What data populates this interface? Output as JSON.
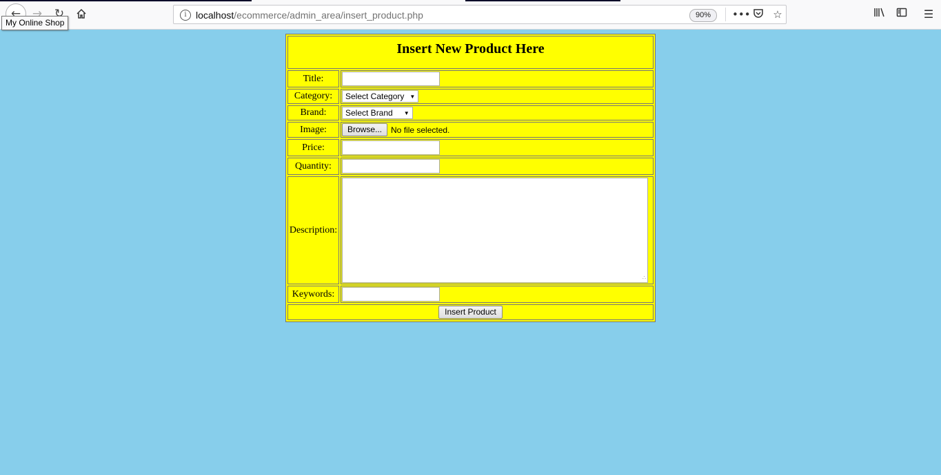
{
  "browser": {
    "tooltip": "My Online Shop",
    "url_host": "localhost",
    "url_path": "/ecommerce/admin_area/insert_product.php",
    "zoom": "90%",
    "icons": [
      "back-icon",
      "forward-icon",
      "reload-icon",
      "home-icon",
      "info-icon",
      "more-icon",
      "pocket-icon",
      "bookmark-star-icon",
      "library-icon",
      "sidebar-icon",
      "menu-icon"
    ]
  },
  "form": {
    "heading": "Insert New Product Here",
    "title_label": "Title:",
    "category_label": "Category:",
    "category_value": "Select Category",
    "brand_label": "Brand:",
    "brand_value": "Select Brand",
    "image_label": "Image:",
    "browse_label": "Browse...",
    "file_status": "No file selected.",
    "price_label": "Price:",
    "quantity_label": "Quantity:",
    "description_label": "Description:",
    "keywords_label": "Keywords:",
    "submit_label": "Insert Product"
  },
  "colors": {
    "page_bg": "#87ceeb",
    "form_bg": "#ffff00"
  }
}
